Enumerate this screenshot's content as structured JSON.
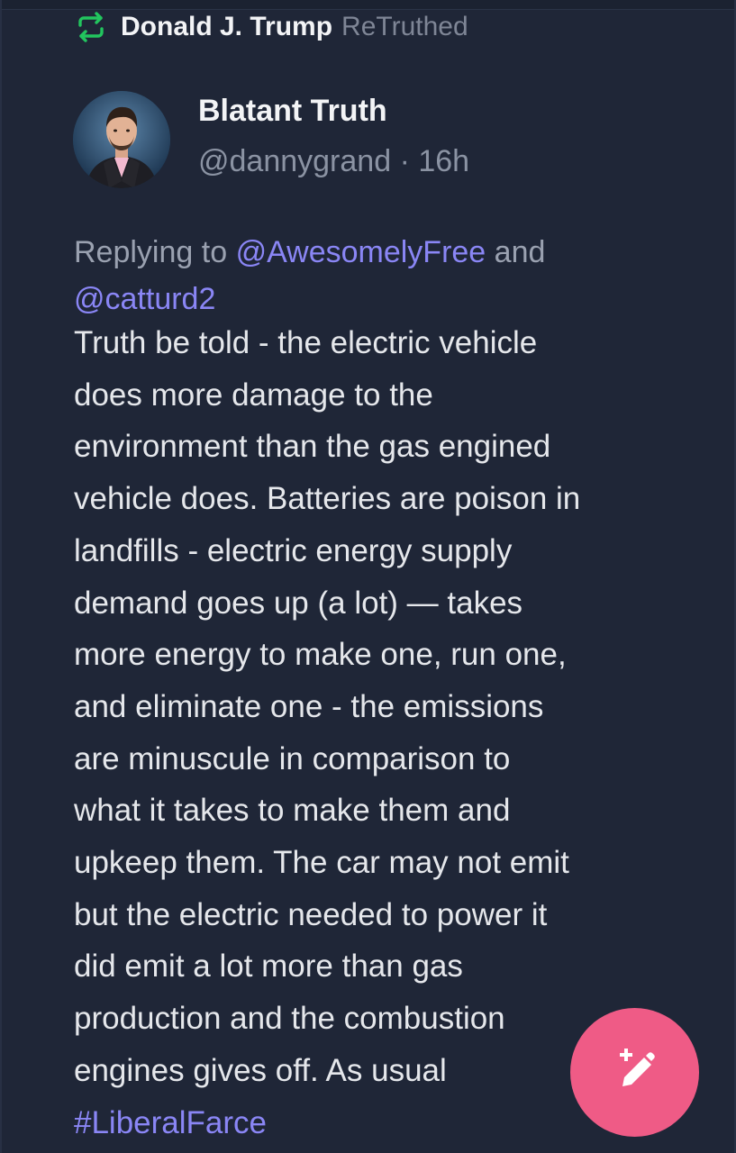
{
  "retruth": {
    "icon": "repost-icon",
    "icon_color": "#22c55e",
    "name": "Donald J. Trump",
    "label": "ReTruthed"
  },
  "author": {
    "display_name": "Blatant Truth",
    "handle": "@dannygrand",
    "separator": "·",
    "time": "16h"
  },
  "reply": {
    "prefix": "Replying to",
    "mention_1": "@AwesomelyFree",
    "conjunction": "and",
    "mention_2": "@catturd2"
  },
  "post": {
    "lines": [
      "Truth be told - the electric vehicle",
      "does more damage to the",
      "environment than the gas engined",
      "vehicle does. Batteries are poison in",
      "landfills - electric energy supply",
      "demand goes up (a lot) — takes",
      "more energy to make one, run one,",
      "and eliminate one - the emissions",
      "are minuscule in comparison to",
      "what it takes to make them and",
      "upkeep them. The car may not emit",
      "but the electric needed to power it",
      "did emit a lot more than gas",
      "production and the combustion",
      "engines gives off. As usual"
    ],
    "hashtag": "#LiberalFarce"
  },
  "compose_button": {
    "icon": "compose-pencil-icon",
    "color": "#ef5b86"
  },
  "colors": {
    "background": "#1f2637",
    "mention": "#8a86f5",
    "text": "#e5e7eb",
    "muted": "#8b93a3"
  }
}
